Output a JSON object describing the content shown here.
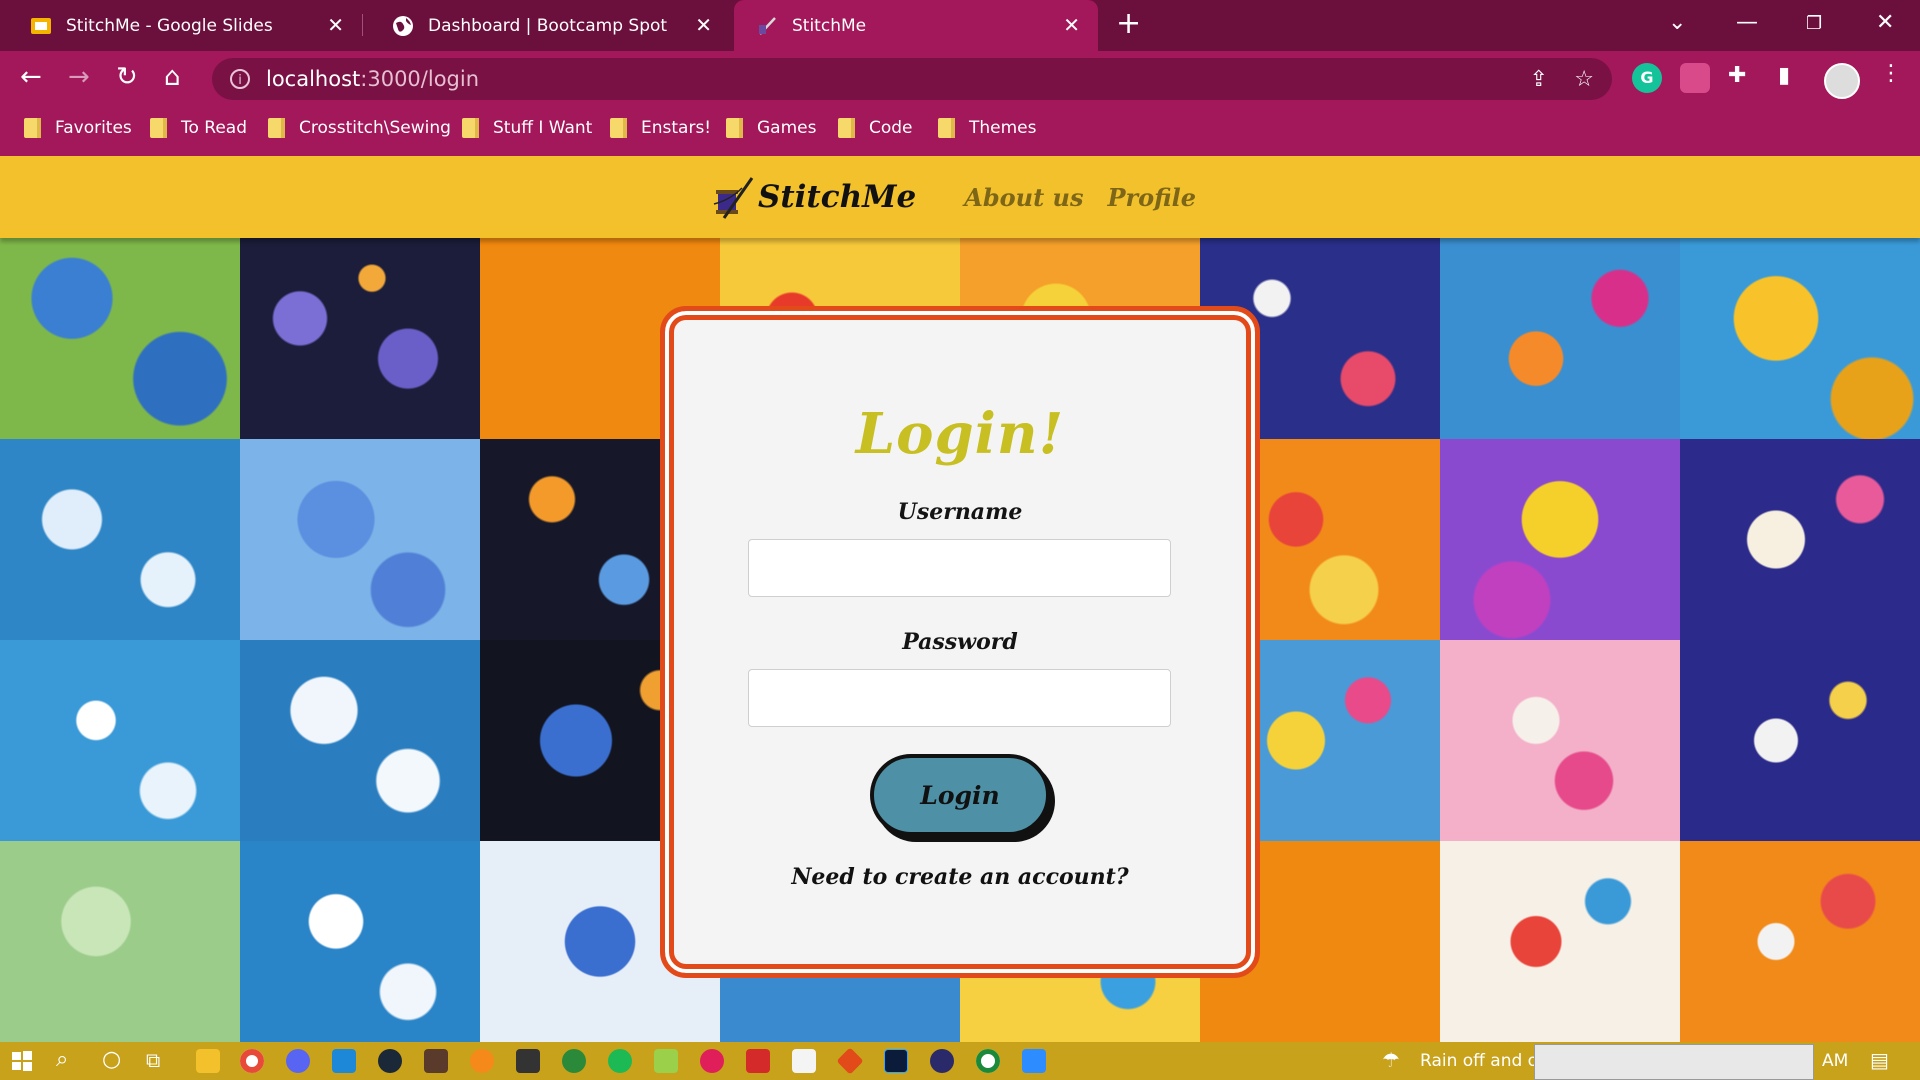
{
  "browser": {
    "tabs": [
      {
        "title": "StitchMe - Google Slides",
        "icon": "slides-icon",
        "active": false
      },
      {
        "title": "Dashboard | Bootcamp Spot",
        "icon": "globe-icon",
        "active": false
      },
      {
        "title": "StitchMe",
        "icon": "needle-icon",
        "active": true
      }
    ],
    "url_host": "localhost",
    "url_path": ":3000/login",
    "bookmarks": [
      "Favorites",
      "To Read",
      "Crosstitch\\Sewing",
      "Stuff I Want",
      "Enstars!",
      "Games",
      "Code",
      "Themes"
    ]
  },
  "site": {
    "brand": "StitchMe",
    "nav": [
      "About us",
      "Profile"
    ]
  },
  "login": {
    "title": "Login!",
    "username_label": "Username",
    "username_value": "",
    "password_label": "Password",
    "password_value": "",
    "button_label": "Login",
    "signup_text": "Need to create an account?"
  },
  "taskbar": {
    "weather": "Rain off and o",
    "time_fragment": "AM"
  },
  "colors": {
    "tabstrip": "#6b0f3c",
    "toolbar": "#a3175b",
    "header": "#f2c12b",
    "card_border": "#e24a1a",
    "title": "#c8bf22",
    "button": "#4e91a6",
    "nav_link": "#7d6618"
  }
}
